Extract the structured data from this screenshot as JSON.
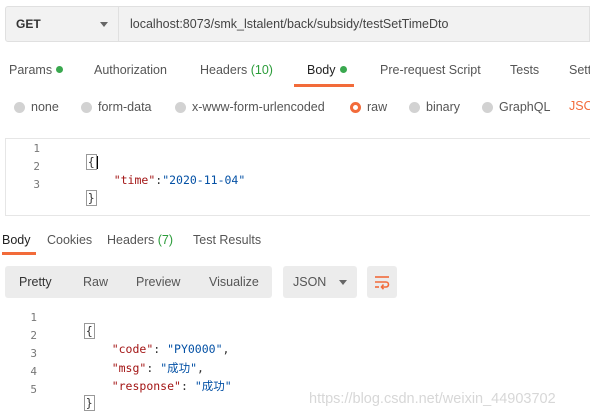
{
  "request": {
    "method": "GET",
    "url": "localhost:8073/smk_lstalent/back/subsidy/testSetTimeDto"
  },
  "request_tabs": {
    "params": "Params",
    "authorization": "Authorization",
    "headers": "Headers",
    "headers_count": "(10)",
    "body": "Body",
    "prerequest": "Pre-request Script",
    "tests": "Tests",
    "settings": "Setti"
  },
  "body_types": {
    "none": "none",
    "form_data": "form-data",
    "urlencoded": "x-www-form-urlencoded",
    "raw": "raw",
    "binary": "binary",
    "graphql": "GraphQL",
    "json": "JSO",
    "selected": "raw"
  },
  "request_body": {
    "line_numbers": [
      "1",
      "2",
      "3"
    ],
    "open": "{",
    "key": "\"time\"",
    "colon": ":",
    "value": "\"2020-11-04\"",
    "close": "}"
  },
  "response_tabs": {
    "body": "Body",
    "cookies": "Cookies",
    "headers": "Headers",
    "headers_count": "(7)",
    "test_results": "Test Results"
  },
  "response_view": {
    "pretty": "Pretty",
    "raw": "Raw",
    "preview": "Preview",
    "visualize": "Visualize",
    "format": "JSON"
  },
  "response_body": {
    "line_numbers": [
      "1",
      "2",
      "3",
      "4",
      "5"
    ],
    "open": "{",
    "code_key": "\"code\"",
    "code_value": "\"PY0000\"",
    "msg_key": "\"msg\"",
    "msg_value": "\"成功\"",
    "response_key": "\"response\"",
    "response_value": "\"成功\"",
    "close": "}"
  },
  "watermark": "https://blog.csdn.net/weixin_44903702",
  "colors": {
    "accent": "#f26b3a",
    "status_dot": "#3aa84f",
    "json_key": "#a31515",
    "json_string": "#0451a5"
  }
}
